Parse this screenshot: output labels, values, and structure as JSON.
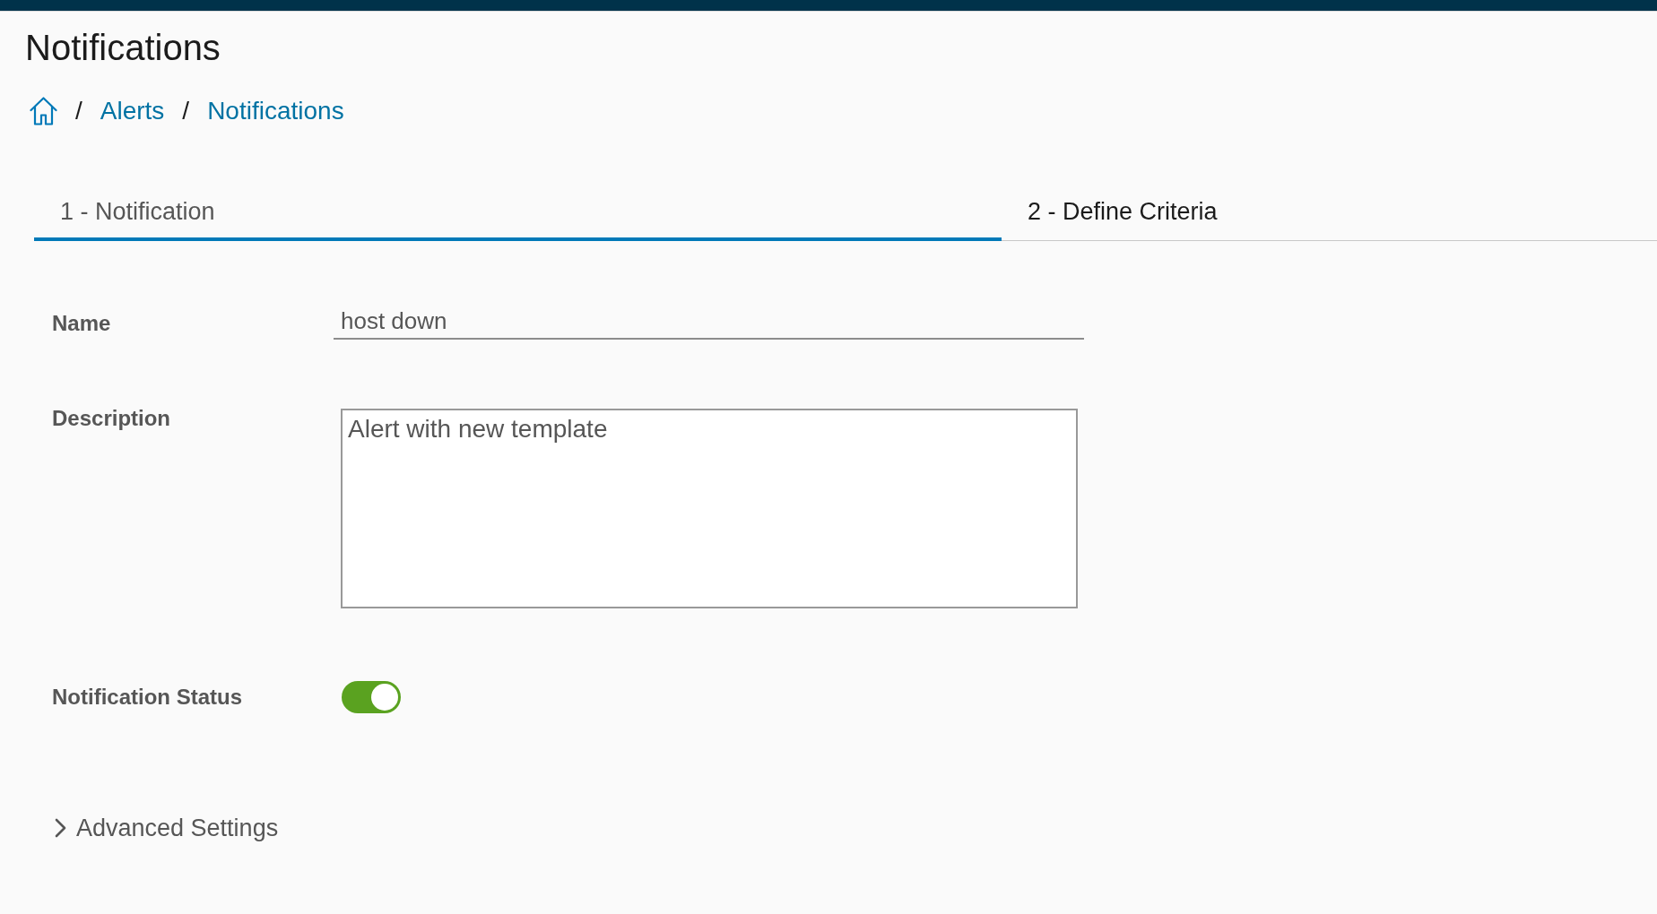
{
  "header": {
    "title": "Notifications"
  },
  "breadcrumb": {
    "items": [
      {
        "kind": "home"
      },
      {
        "kind": "link",
        "label": "Alerts"
      },
      {
        "kind": "link",
        "label": "Notifications"
      }
    ],
    "separators": [
      "/",
      "/"
    ]
  },
  "tabs": [
    {
      "label": "1 - Notification",
      "selected": true
    },
    {
      "label": "2 - Define Criteria",
      "selected": false
    }
  ],
  "form": {
    "name": {
      "label": "Name",
      "value": "host down"
    },
    "description": {
      "label": "Description",
      "value": "Alert with new template"
    },
    "notification_status": {
      "label": "Notification Status",
      "on": true
    }
  },
  "advanced_settings": {
    "label": "Advanced Settings",
    "expanded": false
  }
}
